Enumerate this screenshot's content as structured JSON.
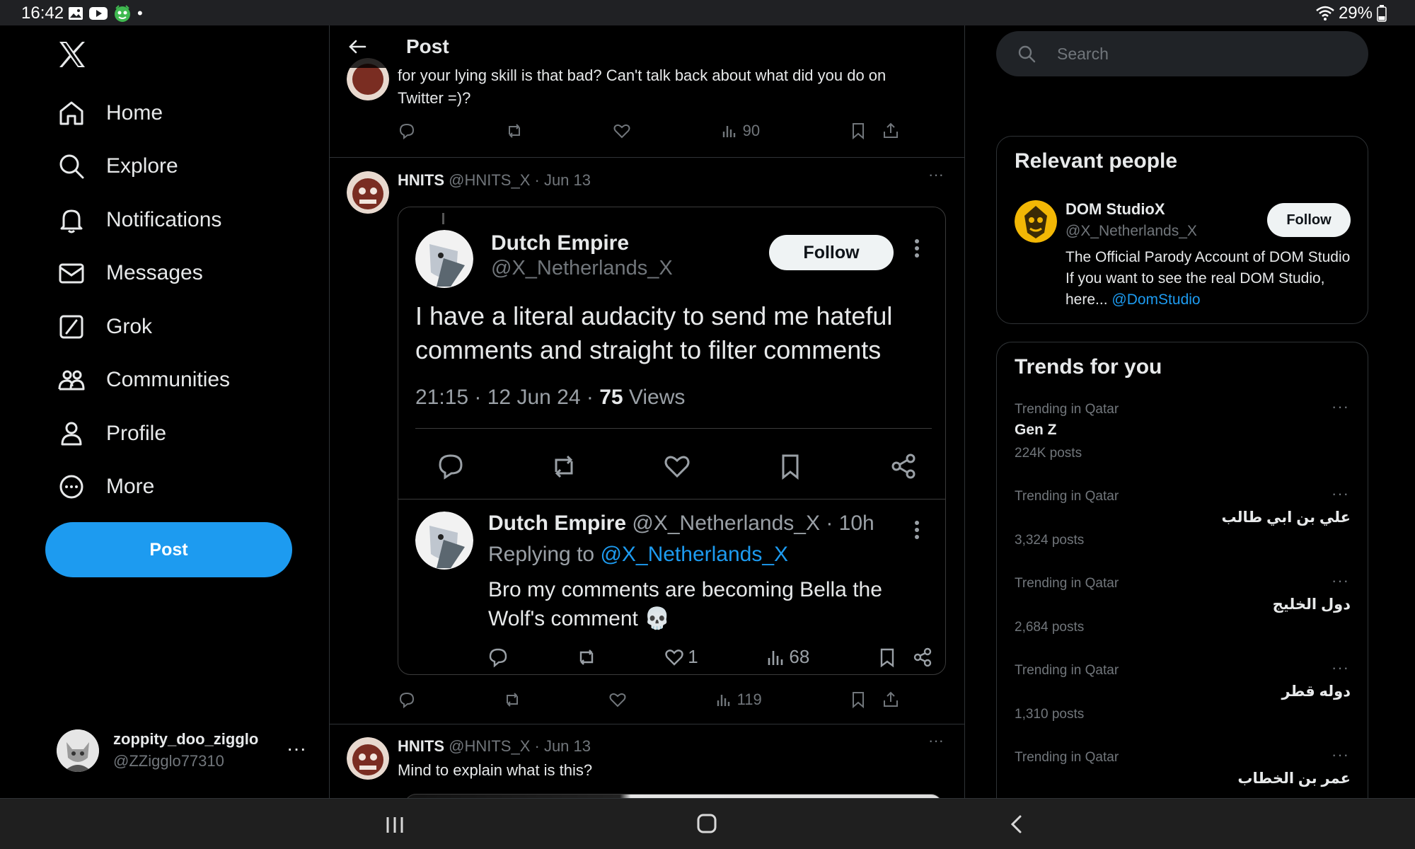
{
  "status_bar": {
    "time": "16:42",
    "battery": "29%"
  },
  "sidebar": {
    "items": [
      {
        "label": "Home",
        "icon": "home-icon"
      },
      {
        "label": "Explore",
        "icon": "search-icon"
      },
      {
        "label": "Notifications",
        "icon": "bell-icon"
      },
      {
        "label": "Messages",
        "icon": "mail-icon"
      },
      {
        "label": "Grok",
        "icon": "grok-icon"
      },
      {
        "label": "Communities",
        "icon": "communities-icon"
      },
      {
        "label": "Profile",
        "icon": "person-icon"
      },
      {
        "label": "More",
        "icon": "more-circle-icon"
      }
    ],
    "post_label": "Post",
    "account": {
      "name": "zoppity_doo_zigglo",
      "handle": "@ZZigglo77310",
      "menu": "···"
    }
  },
  "header": {
    "title": "Post"
  },
  "top_post": {
    "text_partial": "for your lying skill is that bad? Can't talk back about what did you do on",
    "text_line2": "Twitter =)?",
    "views": "90"
  },
  "post1": {
    "author": "HNITS",
    "handle": "@HNITS_X",
    "date": "· Jun 13",
    "views": "119",
    "card": {
      "author": "Dutch Empire",
      "handle": "@X_Netherlands_X",
      "follow": "Follow",
      "text": "I have a literal audacity to send me hateful comments and straight to filter comments",
      "time": "21:15 · 12 Jun 24 ·",
      "views_count": "75",
      "views_label": "Views",
      "reply": {
        "author": "Dutch Empire",
        "handle": "@X_Netherlands_X",
        "age": "· 10h",
        "replying_to_label": "Replying to",
        "replying_to": "@X_Netherlands_X",
        "text": "Bro my comments are becoming Bella the Wolf's comment 💀",
        "likes": "1",
        "views": "68"
      }
    }
  },
  "post2": {
    "author": "HNITS",
    "handle": "@HNITS_X",
    "date": "· Jun 13",
    "text": "Mind to explain what is this?"
  },
  "search": {
    "placeholder": "Search"
  },
  "relevant_people": {
    "title": "Relevant people",
    "name": "DOM StudioX",
    "handle": "@X_Netherlands_X",
    "follow": "Follow",
    "bio": "The Official Parody Account of DOM Studio If you want to see the real DOM Studio, here...",
    "bio_link": "@DomStudio"
  },
  "trends": {
    "title": "Trends for you",
    "items": [
      {
        "context": "Trending in Qatar",
        "name": "Gen Z",
        "posts": "224K posts",
        "rtl": false
      },
      {
        "context": "Trending in Qatar",
        "name": "علي بن ابي طالب",
        "posts": "3,324 posts",
        "rtl": true
      },
      {
        "context": "Trending in Qatar",
        "name": "دول الخليج",
        "posts": "2,684 posts",
        "rtl": true
      },
      {
        "context": "Trending in Qatar",
        "name": "دوله قطر",
        "posts": "1,310 posts",
        "rtl": true
      },
      {
        "context": "Trending in Qatar",
        "name": "عمر بن الخطاب",
        "posts": "",
        "rtl": true
      }
    ]
  },
  "colors": {
    "accent": "#1d9bf0",
    "background": "#000000",
    "muted": "#71767b",
    "border": "#2f3336"
  }
}
